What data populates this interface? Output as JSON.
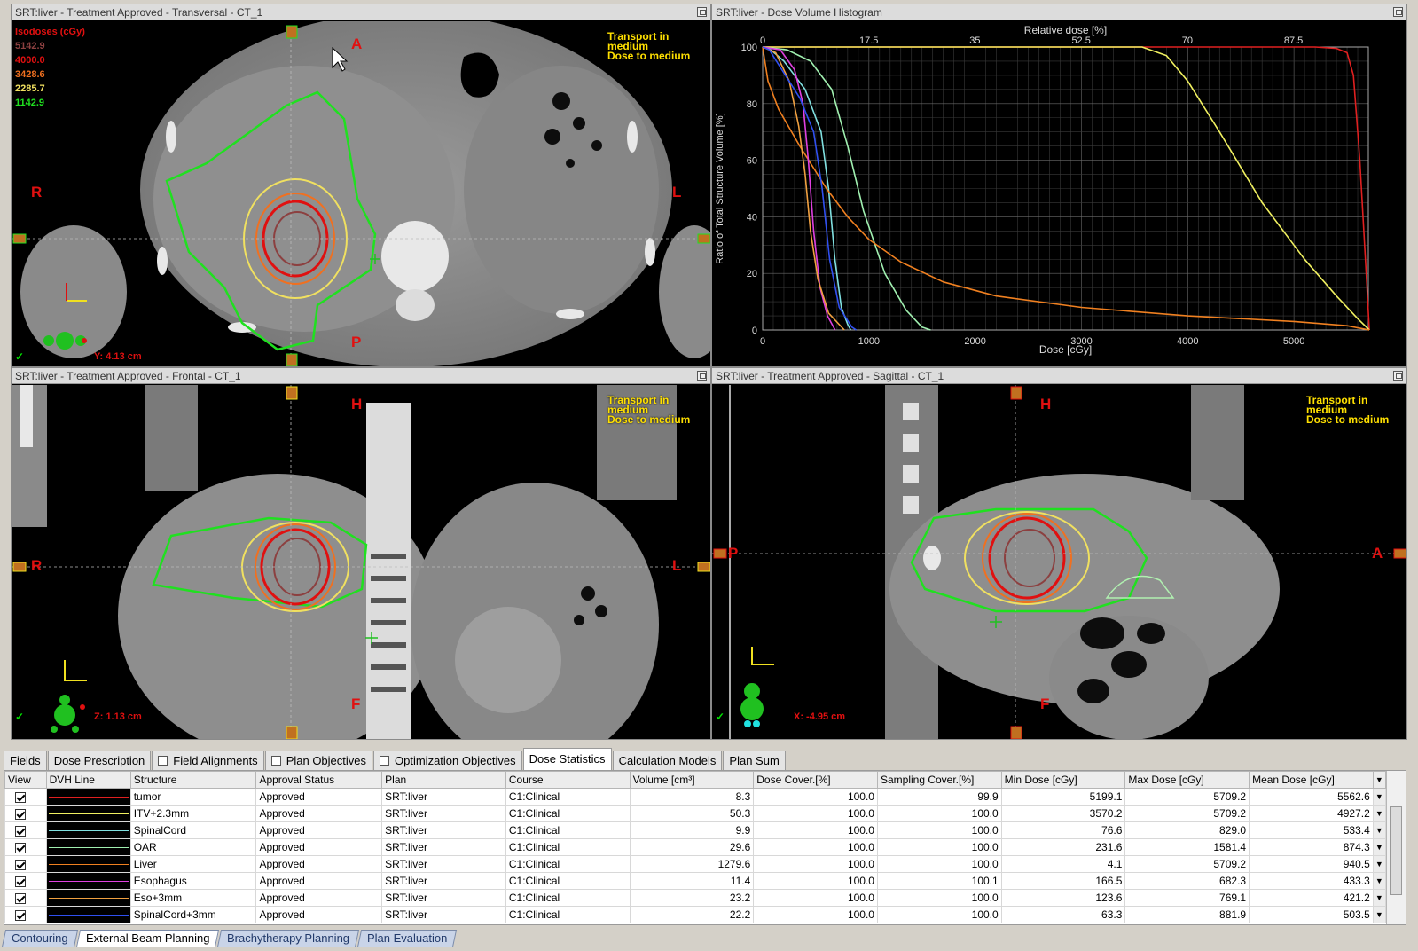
{
  "views": {
    "transversal": {
      "title": "SRT:liver  -  Treatment Approved - Transversal - CT_1",
      "orient": {
        "top": "A",
        "bottom": "P",
        "left": "R",
        "right": "L"
      },
      "coord": "Y: 4.13 cm",
      "isodoses": {
        "title": "Isodoses (cGy)",
        "levels": [
          {
            "value": "5142.9",
            "color": "#8c4040"
          },
          {
            "value": "4000.0",
            "color": "#e01010"
          },
          {
            "value": "3428.6",
            "color": "#f07020"
          },
          {
            "value": "2285.7",
            "color": "#f0e060"
          },
          {
            "value": "1142.9",
            "color": "#20e020"
          }
        ]
      }
    },
    "dvh": {
      "title": "SRT:liver - Dose Volume Histogram"
    },
    "frontal": {
      "title": "SRT:liver  -  Treatment Approved - Frontal - CT_1",
      "orient": {
        "top": "H",
        "bottom": "F",
        "left": "R",
        "right": "L"
      },
      "coord": "Z: 1.13 cm"
    },
    "sagittal": {
      "title": "SRT:liver  -  Treatment Approved - Sagittal - CT_1",
      "orient": {
        "top": "H",
        "bottom": "F",
        "left": "P",
        "right": "A"
      },
      "coord": "X: -4.95 cm"
    },
    "transport_line1": "Transport in",
    "transport_line2": "medium",
    "transport_line3": "Dose to medium",
    "check": "✓"
  },
  "chart_data": {
    "type": "line",
    "xlabel": "Dose [cGy]",
    "ylabel": "Ratio of Total Structure Volume [%]",
    "top_label": "Relative dose [%]",
    "xlim": [
      0,
      5700
    ],
    "ylim": [
      0,
      100
    ],
    "x_ticks": [
      "0",
      "1000",
      "2000",
      "3000",
      "4000",
      "5000"
    ],
    "y_ticks": [
      "0",
      "20",
      "40",
      "60",
      "80",
      "100"
    ],
    "top_ticks": [
      "0",
      "17.5",
      "35",
      "52.5",
      "70",
      "87.5"
    ],
    "grid": true,
    "series": [
      {
        "name": "tumor",
        "color": "#e02020",
        "points": [
          [
            0,
            100
          ],
          [
            5199,
            100
          ],
          [
            5400,
            99.5
          ],
          [
            5500,
            98
          ],
          [
            5560,
            90
          ],
          [
            5620,
            60
          ],
          [
            5680,
            20
          ],
          [
            5709,
            0
          ]
        ]
      },
      {
        "name": "ITV+2.3mm",
        "color": "#f0f060",
        "points": [
          [
            0,
            100
          ],
          [
            3570,
            100
          ],
          [
            3800,
            97
          ],
          [
            4000,
            88
          ],
          [
            4300,
            70
          ],
          [
            4700,
            45
          ],
          [
            5100,
            25
          ],
          [
            5400,
            12
          ],
          [
            5600,
            4
          ],
          [
            5709,
            0
          ]
        ]
      },
      {
        "name": "SpinalCord",
        "color": "#80e0e0",
        "points": [
          [
            0,
            100
          ],
          [
            76,
            99
          ],
          [
            200,
            95
          ],
          [
            400,
            85
          ],
          [
            550,
            70
          ],
          [
            620,
            50
          ],
          [
            680,
            25
          ],
          [
            740,
            8
          ],
          [
            800,
            2
          ],
          [
            829,
            0
          ]
        ]
      },
      {
        "name": "OAR",
        "color": "#a0f0b0",
        "points": [
          [
            0,
            100
          ],
          [
            231,
            99
          ],
          [
            450,
            95
          ],
          [
            650,
            85
          ],
          [
            800,
            65
          ],
          [
            950,
            42
          ],
          [
            1150,
            20
          ],
          [
            1350,
            7
          ],
          [
            1500,
            1
          ],
          [
            1581,
            0
          ]
        ]
      },
      {
        "name": "Liver",
        "color": "#f08020",
        "points": [
          [
            0,
            100
          ],
          [
            50,
            88
          ],
          [
            150,
            78
          ],
          [
            350,
            65
          ],
          [
            600,
            50
          ],
          [
            800,
            40
          ],
          [
            1000,
            32
          ],
          [
            1300,
            24
          ],
          [
            1700,
            17
          ],
          [
            2200,
            12
          ],
          [
            3000,
            8
          ],
          [
            4000,
            5
          ],
          [
            5000,
            3
          ],
          [
            5500,
            1.5
          ],
          [
            5709,
            0
          ]
        ]
      },
      {
        "name": "Esophagus",
        "color": "#e040e0",
        "points": [
          [
            0,
            100
          ],
          [
            166,
            99
          ],
          [
            300,
            92
          ],
          [
            380,
            80
          ],
          [
            430,
            60
          ],
          [
            480,
            35
          ],
          [
            540,
            15
          ],
          [
            610,
            5
          ],
          [
            682,
            0
          ]
        ]
      },
      {
        "name": "Eso+3mm",
        "color": "#f0a040",
        "points": [
          [
            0,
            100
          ],
          [
            123,
            98
          ],
          [
            250,
            88
          ],
          [
            340,
            72
          ],
          [
            400,
            55
          ],
          [
            450,
            35
          ],
          [
            520,
            18
          ],
          [
            620,
            6
          ],
          [
            769,
            0
          ]
        ]
      },
      {
        "name": "SpinalCord+3mm",
        "color": "#3050f0",
        "points": [
          [
            0,
            100
          ],
          [
            63,
            99
          ],
          [
            180,
            92
          ],
          [
            350,
            82
          ],
          [
            480,
            70
          ],
          [
            560,
            50
          ],
          [
            630,
            25
          ],
          [
            720,
            8
          ],
          [
            840,
            1
          ],
          [
            881,
            0
          ]
        ]
      }
    ]
  },
  "tabs": [
    {
      "label": "Fields",
      "checkbox": false,
      "active": false
    },
    {
      "label": "Dose Prescription",
      "checkbox": false,
      "active": false
    },
    {
      "label": "Field Alignments",
      "checkbox": true,
      "active": false
    },
    {
      "label": "Plan Objectives",
      "checkbox": true,
      "active": false
    },
    {
      "label": "Optimization Objectives",
      "checkbox": true,
      "active": false
    },
    {
      "label": "Dose Statistics",
      "checkbox": false,
      "active": true
    },
    {
      "label": "Calculation Models",
      "checkbox": false,
      "active": false
    },
    {
      "label": "Plan Sum",
      "checkbox": false,
      "active": false
    }
  ],
  "table": {
    "columns": [
      "View",
      "DVH Line",
      "Structure",
      "Approval Status",
      "Plan",
      "Course",
      "Volume [cm³]",
      "Dose Cover.[%]",
      "Sampling Cover.[%]",
      "Min Dose [cGy]",
      "Max Dose [cGy]",
      "Mean Dose [cGy]"
    ],
    "rows": [
      {
        "structure": "tumor",
        "line_color": "#e02020",
        "approval": "Approved",
        "plan": "SRT:liver",
        "course": "C1:Clinical",
        "volume": "8.3",
        "dose_cover": "100.0",
        "sampling_cover": "99.9",
        "min": "5199.1",
        "max": "5709.2",
        "mean": "5562.6"
      },
      {
        "structure": "ITV+2.3mm",
        "line_color": "#f0f060",
        "approval": "Approved",
        "plan": "SRT:liver",
        "course": "C1:Clinical",
        "volume": "50.3",
        "dose_cover": "100.0",
        "sampling_cover": "100.0",
        "min": "3570.2",
        "max": "5709.2",
        "mean": "4927.2"
      },
      {
        "structure": "SpinalCord",
        "line_color": "#80e0e0",
        "approval": "Approved",
        "plan": "SRT:liver",
        "course": "C1:Clinical",
        "volume": "9.9",
        "dose_cover": "100.0",
        "sampling_cover": "100.0",
        "min": "76.6",
        "max": "829.0",
        "mean": "533.4"
      },
      {
        "structure": "OAR",
        "line_color": "#a0f0b0",
        "approval": "Approved",
        "plan": "SRT:liver",
        "course": "C1:Clinical",
        "volume": "29.6",
        "dose_cover": "100.0",
        "sampling_cover": "100.0",
        "min": "231.6",
        "max": "1581.4",
        "mean": "874.3"
      },
      {
        "structure": "Liver",
        "line_color": "#f08020",
        "approval": "Approved",
        "plan": "SRT:liver",
        "course": "C1:Clinical",
        "volume": "1279.6",
        "dose_cover": "100.0",
        "sampling_cover": "100.0",
        "min": "4.1",
        "max": "5709.2",
        "mean": "940.5"
      },
      {
        "structure": "Esophagus",
        "line_color": "#e040e0",
        "approval": "Approved",
        "plan": "SRT:liver",
        "course": "C1:Clinical",
        "volume": "11.4",
        "dose_cover": "100.0",
        "sampling_cover": "100.1",
        "min": "166.5",
        "max": "682.3",
        "mean": "433.3"
      },
      {
        "structure": "Eso+3mm",
        "line_color": "#f0a040",
        "approval": "Approved",
        "plan": "SRT:liver",
        "course": "C1:Clinical",
        "volume": "23.2",
        "dose_cover": "100.0",
        "sampling_cover": "100.0",
        "min": "123.6",
        "max": "769.1",
        "mean": "421.2"
      },
      {
        "structure": "SpinalCord+3mm",
        "line_color": "#3050f0",
        "approval": "Approved",
        "plan": "SRT:liver",
        "course": "C1:Clinical",
        "volume": "22.2",
        "dose_cover": "100.0",
        "sampling_cover": "100.0",
        "min": "63.3",
        "max": "881.9",
        "mean": "503.5"
      }
    ]
  },
  "workspaces": [
    {
      "label": "Contouring",
      "active": false
    },
    {
      "label": "External Beam Planning",
      "active": true
    },
    {
      "label": "Brachytherapy Planning",
      "active": false
    },
    {
      "label": "Plan Evaluation",
      "active": false
    }
  ]
}
